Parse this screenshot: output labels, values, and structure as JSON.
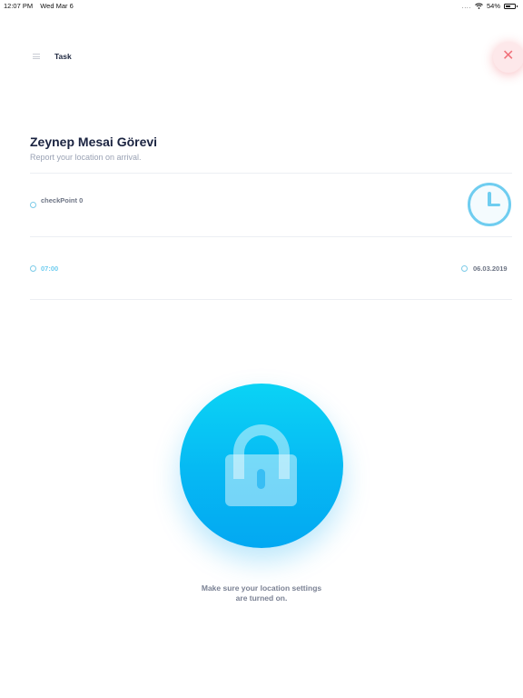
{
  "status_bar": {
    "time": "12:07 PM",
    "date": "Wed Mar 6",
    "signal": "....",
    "battery": "54%"
  },
  "header": {
    "title": "Task",
    "close_icon": "close-icon",
    "close_color": "#f0707a"
  },
  "task": {
    "title": "Zeynep Mesai Görevi",
    "subtitle": "Report your location on arrival."
  },
  "checkpoint": {
    "label": "checkPoint 0",
    "icon": "location-icon",
    "clock_icon": "clock-icon"
  },
  "schedule": {
    "time": "07:00",
    "date": "06.03.2019"
  },
  "lock": {
    "icon": "lock-icon",
    "color": "#06b8f3"
  },
  "hint": {
    "line1": "Make sure your location settings",
    "line2": "are turned on."
  }
}
